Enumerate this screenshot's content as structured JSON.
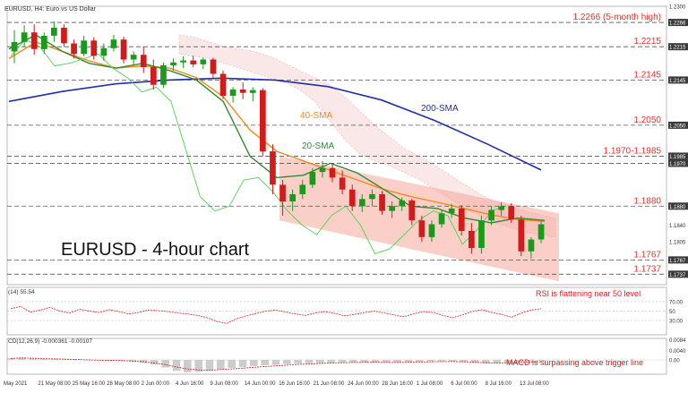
{
  "header": {
    "symbol": "EURUSD, H4: Euro vs US Dollar"
  },
  "chart_data": {
    "type": "line",
    "title": "EURUSD - 4-hour chart",
    "ylim": [
      1.1715,
      1.23
    ],
    "price_ticks": [
      {
        "label": "1.2300",
        "value": 1.23
      },
      {
        "label": "1.2266",
        "value": 1.2266,
        "hl": true
      },
      {
        "label": "1.2215",
        "value": 1.2215,
        "hl": true
      },
      {
        "label": "1.2145",
        "value": 1.2145,
        "hl": true
      },
      {
        "label": "1.2050",
        "value": 1.205,
        "hl": true
      },
      {
        "label": "1.1985",
        "value": 1.1985,
        "hl": true
      },
      {
        "label": "1.1970",
        "value": 1.197,
        "hl": true
      },
      {
        "label": "1.1880",
        "value": 1.188,
        "hl": true
      },
      {
        "label": "1.1840",
        "value": 1.184
      },
      {
        "label": "1.1805",
        "value": 1.1805
      },
      {
        "label": "1.1767",
        "value": 1.1767,
        "hl": true
      },
      {
        "label": "1.1737",
        "value": 1.1737,
        "hl": true
      }
    ],
    "levels": [
      {
        "label": "1.2266 (5-month high)",
        "values": [
          1.2266
        ]
      },
      {
        "label": "1.2215",
        "values": [
          1.2215
        ]
      },
      {
        "label": "1.2145",
        "values": [
          1.2145
        ]
      },
      {
        "label": "1.2050",
        "values": [
          1.205
        ]
      },
      {
        "label": "1.1970-1.1985",
        "values": [
          1.1985,
          1.197
        ]
      },
      {
        "label": "1.1880",
        "values": [
          1.188
        ]
      },
      {
        "label": "1.1767",
        "values": [
          1.1767
        ]
      },
      {
        "label": "1.1737",
        "values": [
          1.1737
        ]
      }
    ],
    "x_labels": [
      "May 2021",
      "21 May 08:00",
      "25 May 16:00",
      "28 May 08:00",
      "2 Jun 00:00",
      "4 Jun 16:00",
      "9 Jun 08:00",
      "14 Jun 00:00",
      "16 Jun 16:00",
      "21 Jun 08:00",
      "24 Jun 00:00",
      "28 Jun 16:00",
      "1 Jul 08:00",
      "6 Jul 00:00",
      "8 Jul 16:00",
      "13 Jul 08:00"
    ],
    "series": [
      {
        "name": "200-SMA",
        "color": "#1f2fa8",
        "values": [
          1.21,
          1.2121,
          1.2137,
          1.2145,
          1.2149,
          1.2145,
          1.2131,
          1.2103,
          1.206,
          1.201,
          1.1956
        ]
      },
      {
        "name": "40-SMA",
        "color": "#f08a1c",
        "values": [
          1.219,
          1.2225,
          1.2205,
          1.2185,
          1.217,
          1.2175,
          1.217,
          1.215,
          1.211,
          1.204,
          1.1995,
          1.1975,
          1.1955,
          1.1935,
          1.1915,
          1.19,
          1.1888,
          1.1875,
          1.1862,
          1.1852,
          1.1848
        ]
      },
      {
        "name": "20-SMA",
        "color": "#2e8b2e",
        "values": [
          1.221,
          1.224,
          1.2205,
          1.218,
          1.217,
          1.218,
          1.2165,
          1.2145,
          1.21,
          1.1985,
          1.194,
          1.1945,
          1.197,
          1.195,
          1.1915,
          1.188,
          1.1875,
          1.1855,
          1.1845,
          1.1855,
          1.185
        ]
      }
    ],
    "candles": [
      [
        1.2205,
        1.225,
        1.218,
        1.2225
      ],
      [
        1.2225,
        1.226,
        1.2215,
        1.2245
      ],
      [
        1.2245,
        1.2262,
        1.2198,
        1.221
      ],
      [
        1.221,
        1.2245,
        1.22,
        1.2238
      ],
      [
        1.2238,
        1.2268,
        1.2225,
        1.2255
      ],
      [
        1.2255,
        1.2262,
        1.2215,
        1.2222
      ],
      [
        1.2222,
        1.223,
        1.219,
        1.22
      ],
      [
        1.22,
        1.2238,
        1.2195,
        1.2228
      ],
      [
        1.2228,
        1.2235,
        1.2188,
        1.2196
      ],
      [
        1.2196,
        1.2222,
        1.2185,
        1.2212
      ],
      [
        1.2212,
        1.224,
        1.2205,
        1.223
      ],
      [
        1.223,
        1.2236,
        1.218,
        1.2188
      ],
      [
        1.2188,
        1.2205,
        1.2178,
        1.2198
      ],
      [
        1.2198,
        1.2215,
        1.216,
        1.2172
      ],
      [
        1.2172,
        1.2188,
        1.2125,
        1.2135
      ],
      [
        1.2135,
        1.2182,
        1.2128,
        1.2176
      ],
      [
        1.2176,
        1.219,
        1.2165,
        1.2182
      ],
      [
        1.2182,
        1.2195,
        1.217,
        1.2186
      ],
      [
        1.2186,
        1.2196,
        1.2172,
        1.2178
      ],
      [
        1.2178,
        1.2192,
        1.2168,
        1.2188
      ],
      [
        1.2188,
        1.2192,
        1.215,
        1.2158
      ],
      [
        1.2158,
        1.2165,
        1.2105,
        1.2112
      ],
      [
        1.2112,
        1.213,
        1.2098,
        1.2125
      ],
      [
        1.2125,
        1.214,
        1.2105,
        1.2118
      ],
      [
        1.2118,
        1.213,
        1.21,
        1.2124
      ],
      [
        1.2124,
        1.2128,
        1.1985,
        1.1995
      ],
      [
        1.1995,
        1.201,
        1.1905,
        1.1925
      ],
      [
        1.1925,
        1.1935,
        1.186,
        1.189
      ],
      [
        1.189,
        1.1915,
        1.187,
        1.1905
      ],
      [
        1.1905,
        1.1935,
        1.1895,
        1.1925
      ],
      [
        1.1925,
        1.196,
        1.1918,
        1.1952
      ],
      [
        1.1952,
        1.1975,
        1.194,
        1.196
      ],
      [
        1.196,
        1.197,
        1.193,
        1.194
      ],
      [
        1.194,
        1.1955,
        1.1905,
        1.1915
      ],
      [
        1.1915,
        1.1925,
        1.187,
        1.188
      ],
      [
        1.188,
        1.1905,
        1.1868,
        1.1895
      ],
      [
        1.1895,
        1.1915,
        1.188,
        1.1905
      ],
      [
        1.1905,
        1.1912,
        1.1862,
        1.187
      ],
      [
        1.187,
        1.189,
        1.1855,
        1.188
      ],
      [
        1.188,
        1.1898,
        1.187,
        1.1892
      ],
      [
        1.1892,
        1.1895,
        1.184,
        1.185
      ],
      [
        1.185,
        1.186,
        1.1805,
        1.1815
      ],
      [
        1.1815,
        1.185,
        1.1805,
        1.1842
      ],
      [
        1.1842,
        1.1872,
        1.1835,
        1.1865
      ],
      [
        1.1865,
        1.1885,
        1.1855,
        1.1875
      ],
      [
        1.1875,
        1.1882,
        1.1818,
        1.1828
      ],
      [
        1.1828,
        1.1845,
        1.178,
        1.1792
      ],
      [
        1.1792,
        1.186,
        1.178,
        1.185
      ],
      [
        1.185,
        1.188,
        1.184,
        1.1872
      ],
      [
        1.1872,
        1.1888,
        1.186,
        1.188
      ],
      [
        1.188,
        1.1886,
        1.1845,
        1.1852
      ],
      [
        1.1852,
        1.186,
        1.1775,
        1.1785
      ],
      [
        1.1785,
        1.1815,
        1.177,
        1.181
      ],
      [
        1.181,
        1.1848,
        1.1802,
        1.1842
      ]
    ],
    "cloud": [
      [
        1.224,
        1.22
      ],
      [
        1.2235,
        1.2195
      ],
      [
        1.2225,
        1.219
      ],
      [
        1.2215,
        1.218
      ],
      [
        1.221,
        1.217
      ],
      [
        1.2205,
        1.216
      ],
      [
        1.2195,
        1.215
      ],
      [
        1.218,
        1.214
      ],
      [
        1.2165,
        1.2125
      ],
      [
        1.215,
        1.21
      ],
      [
        1.2135,
        1.206
      ],
      [
        1.211,
        1.202
      ],
      [
        1.208,
        1.199
      ],
      [
        1.205,
        1.1975
      ],
      [
        1.2025,
        1.1965
      ],
      [
        1.2,
        1.195
      ],
      [
        1.1985,
        1.1935
      ],
      [
        1.1965,
        1.1915
      ],
      [
        1.1945,
        1.1895
      ],
      [
        1.1925,
        1.1875
      ],
      [
        1.1905,
        1.186
      ],
      [
        1.189,
        1.1845
      ],
      [
        1.188,
        1.1835
      ],
      [
        1.187,
        1.1825
      ],
      [
        1.1862,
        1.182
      ],
      [
        1.1855,
        1.1815
      ]
    ],
    "lagging_span": [
      1.2195,
      1.223,
      1.2215,
      1.2175,
      1.218,
      1.219,
      1.22,
      1.217,
      1.215,
      1.212,
      1.213,
      1.21,
      1.2,
      1.19,
      1.187,
      1.188,
      1.1935,
      1.194,
      1.191,
      1.187,
      1.184,
      1.182,
      1.186,
      1.188,
      1.184,
      1.178,
      1.179,
      1.182,
      1.185,
      1.187,
      1.186,
      1.18,
      1.183,
      1.187,
      1.188
    ],
    "annotations": [
      "200-SMA",
      "40-SMA",
      "20-SMA"
    ],
    "rsi": {
      "label": "(14) 55.54",
      "ticks": [
        {
          "label": "70.00",
          "value": 70
        },
        {
          "label": "50",
          "value": 50
        },
        {
          "label": "30.00",
          "value": 30
        }
      ],
      "note": "RSI is flattening near 50 level",
      "values": [
        55,
        60,
        48,
        52,
        58,
        50,
        46,
        54,
        50,
        47,
        53,
        49,
        44,
        47,
        52,
        51,
        49,
        46,
        44,
        41,
        36,
        28,
        24,
        34,
        40,
        45,
        50,
        52,
        48,
        44,
        41,
        46,
        49,
        45,
        40,
        43,
        47,
        50,
        46,
        42,
        38,
        44,
        49,
        47,
        41,
        36,
        42,
        49,
        53,
        47,
        43,
        37,
        46,
        52,
        55
      ]
    },
    "macd": {
      "label": "CD(12,26,9) -0.000361 -0.00107",
      "ticks": [
        {
          "label": "0.0084",
          "value": 0.0084
        },
        {
          "label": "0.0040",
          "value": 0.004
        },
        {
          "label": "0.00",
          "value": 0
        }
      ],
      "note": "MACD is surpassing above trigger line",
      "values": [
        0.0008,
        0.001,
        0.0006,
        0.0004,
        0.0005,
        0.0003,
        0.0001,
        -0.0001,
        -0.0002,
        -0.0003,
        -0.0004,
        -0.0007,
        -0.0012,
        -0.002,
        -0.0032,
        -0.0045,
        -0.0052,
        -0.005,
        -0.0046,
        -0.004,
        -0.0034,
        -0.003,
        -0.0026,
        -0.0023,
        -0.0021,
        -0.0018,
        -0.0016,
        -0.0014,
        -0.0013,
        -0.0012,
        -0.0011,
        -0.001,
        -0.001,
        -0.0011,
        -0.0012,
        -0.0011,
        -0.001,
        -0.0008,
        -0.0006,
        -0.0005,
        -0.0006,
        -0.0009,
        -0.0012,
        -0.0015,
        -0.0014,
        -0.0012,
        -0.0009,
        -0.0006,
        -0.0004
      ],
      "signal": [
        0.0006,
        0.0008,
        0.0007,
        0.0005,
        0.0004,
        0.0003,
        0.0002,
        0.0,
        -0.0001,
        -0.0002,
        -0.0003,
        -0.0005,
        -0.0008,
        -0.0013,
        -0.002,
        -0.003,
        -0.0038,
        -0.0042,
        -0.0043,
        -0.0041,
        -0.0038,
        -0.0035,
        -0.0031,
        -0.0028,
        -0.0025,
        -0.0022,
        -0.0019,
        -0.0017,
        -0.0015,
        -0.0013,
        -0.0012,
        -0.0011,
        -0.001,
        -0.001,
        -0.0011,
        -0.0011,
        -0.001,
        -0.0009,
        -0.0008,
        -0.0007,
        -0.0007,
        -0.0008,
        -0.001,
        -0.0012,
        -0.0013,
        -0.0013,
        -0.0011,
        -0.0009,
        -0.0008
      ]
    },
    "colors": {
      "up": "#1a9a1a",
      "down": "#d21b1b",
      "level_line": "#555555",
      "level_label": "#e0352c",
      "channel": "#f4a89a",
      "cloud": "#f1b9b9",
      "lagging": "#4fd34f",
      "rsi": "#d62020",
      "macd_line": "#d62020",
      "macd_hist": "#cccccc"
    }
  }
}
